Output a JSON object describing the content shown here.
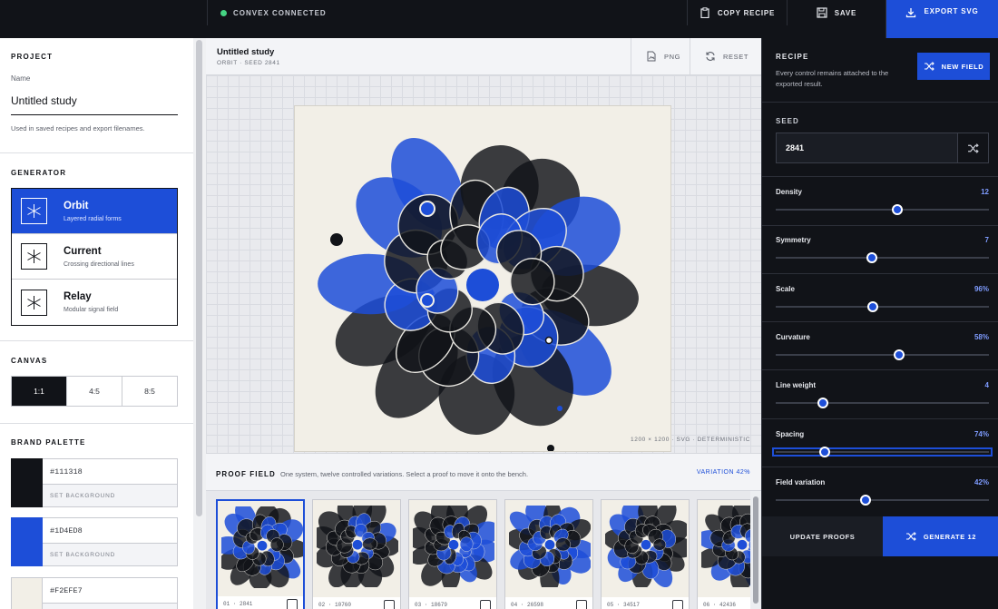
{
  "topbar": {
    "status": "CONVEX CONNECTED",
    "copy_label": "COPY RECIPE",
    "save_label": "SAVE",
    "export_label": "EXPORT SVG"
  },
  "project": {
    "title": "PROJECT",
    "name_label": "Name",
    "name_value": "Untitled study",
    "hint": "Used in saved recipes and export filenames."
  },
  "generator": {
    "title": "GENERATOR",
    "items": [
      {
        "name": "Orbit",
        "sub": "Layered radial forms"
      },
      {
        "name": "Current",
        "sub": "Crossing directional lines"
      },
      {
        "name": "Relay",
        "sub": "Modular signal field"
      }
    ]
  },
  "canvas": {
    "title": "CANVAS",
    "ratios": [
      "1:1",
      "4:5",
      "8:5"
    ]
  },
  "palette": {
    "title": "BRAND PALETTE",
    "set_bg_label": "SET BACKGROUND",
    "swatches": [
      {
        "hex": "#111318"
      },
      {
        "hex": "#1D4ED8"
      },
      {
        "hex": "#F2EFE7"
      }
    ]
  },
  "stage": {
    "title": "Untitled study",
    "subtitle": "ORBIT · SEED 2841",
    "png_label": "PNG",
    "reset_label": "RESET",
    "meta": "1200 × 1200 · SVG · DETERMINISTIC"
  },
  "proofs": {
    "title": "PROOF FIELD",
    "desc": "One system, twelve controlled variations. Select a proof to move it onto the bench.",
    "variation": "VARIATION 42%",
    "items": [
      {
        "label": "01 · 2841"
      },
      {
        "label": "02 · 10760"
      },
      {
        "label": "03 · 18679"
      },
      {
        "label": "04 · 26598"
      },
      {
        "label": "05 · 34517"
      },
      {
        "label": "06 · 42436"
      }
    ]
  },
  "recipe": {
    "title": "RECIPE",
    "desc": "Every control remains attached to the exported result.",
    "new_field": "NEW FIELD",
    "seed_label": "SEED",
    "seed_value": "2841",
    "sliders": [
      {
        "label": "Density",
        "value": "12",
        "level": 0.57
      },
      {
        "label": "Symmetry",
        "value": "7",
        "level": 0.45
      },
      {
        "label": "Scale",
        "value": "96%",
        "level": 0.455
      },
      {
        "label": "Curvature",
        "value": "58%",
        "level": 0.58
      },
      {
        "label": "Line weight",
        "value": "4",
        "level": 0.22
      },
      {
        "label": "Spacing",
        "value": "74%",
        "level": 0.23
      },
      {
        "label": "Field variation",
        "value": "42%",
        "level": 0.42
      }
    ],
    "update_label": "UPDATE PROOFS",
    "generate_label": "GENERATE 12"
  },
  "colors": {
    "ink": "#111318",
    "accent": "#1D4ED8",
    "paper": "#F2EFE7"
  }
}
